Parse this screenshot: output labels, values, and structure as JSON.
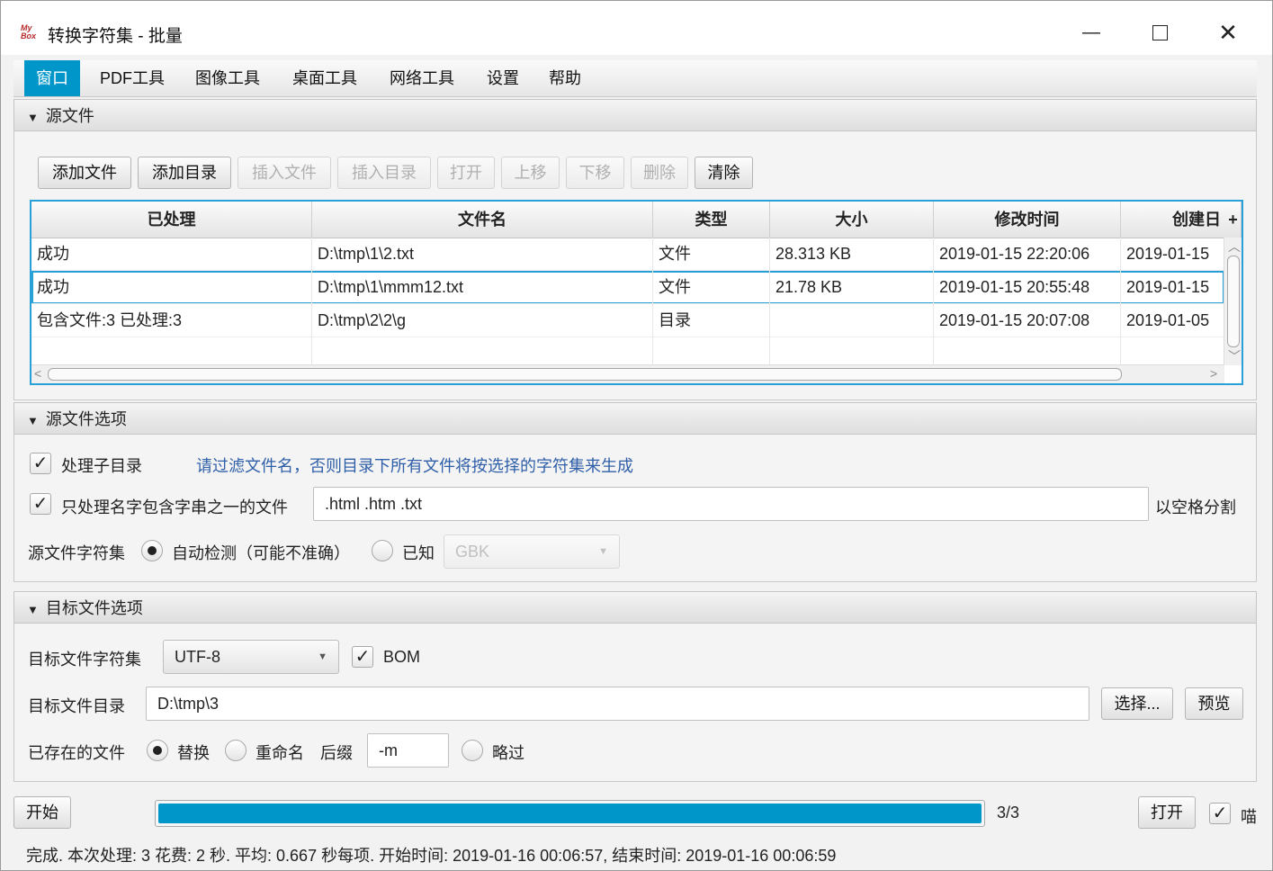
{
  "window": {
    "logo_text": "My Box",
    "title": "转换字符集 - 批量",
    "minimize_glyph": "—",
    "close_glyph": "✕"
  },
  "menu": [
    "窗口",
    "PDF工具",
    "图像工具",
    "桌面工具",
    "网络工具",
    "设置",
    "帮助"
  ],
  "source_files": {
    "header": "源文件",
    "toolbar": {
      "add_file": "添加文件",
      "add_dir": "添加目录",
      "insert_file": "插入文件",
      "insert_dir": "插入目录",
      "open": "打开",
      "move_up": "上移",
      "move_down": "下移",
      "delete": "删除",
      "clear": "清除"
    },
    "columns": [
      "已处理",
      "文件名",
      "类型",
      "大小",
      "修改时间",
      "创建日"
    ],
    "column_menu_glyph": "+",
    "rows": [
      [
        "成功",
        "D:\\tmp\\1\\2.txt",
        "文件",
        "28.313 KB",
        "2019-01-15 22:20:06",
        "2019-01-15"
      ],
      [
        "成功",
        "D:\\tmp\\1\\mmm12.txt",
        "文件",
        "21.78 KB",
        "2019-01-15 20:55:48",
        "2019-01-15"
      ],
      [
        "包含文件:3  已处理:3",
        "D:\\tmp\\2\\2\\g",
        "目录",
        "",
        "2019-01-15 20:07:08",
        "2019-01-05"
      ]
    ],
    "selected_row": 1
  },
  "source_options": {
    "header": "源文件选项",
    "subdir_label": "处理子目录",
    "subdir_checked": true,
    "subdir_hint": "请过滤文件名，否则目录下所有文件将按选择的字符集来生成",
    "filter_label": "只处理名字包含字串之一的文件",
    "filter_checked": true,
    "filter_value": ".html  .htm  .txt",
    "filter_note": "以空格分割",
    "charset_label": "源文件字符集",
    "auto_label": "自动检测（可能不准确）",
    "known_label": "已知",
    "known_value": "GBK",
    "auto_selected": true
  },
  "target_options": {
    "header": "目标文件选项",
    "charset_label": "目标文件字符集",
    "charset_value": "UTF-8",
    "bom_label": "BOM",
    "bom_checked": true,
    "dir_label": "目标文件目录",
    "dir_value": "D:\\tmp\\3",
    "choose_button": "选择...",
    "preview_button": "预览",
    "exists_label": "已存在的文件",
    "replace_label": "替换",
    "rename_label": "重命名",
    "suffix_label": "后缀",
    "suffix_value": "-m",
    "skip_label": "略过",
    "replace_selected": true
  },
  "bottom": {
    "start_button": "开始",
    "progress": 1.0,
    "progress_text": "3/3",
    "open_button": "打开",
    "meow_label": "喵",
    "meow_checked": true
  },
  "status_text": "完成. 本次处理: 3 花费: 2 秒. 平均: 0.667 秒每项. 开始时间: 2019-01-16 00:06:57, 结束时间: 2019-01-16 00:06:59",
  "colors": {
    "accent": "#0096c9",
    "selection_border": "#2aa0d8",
    "hint_text": "#2f5fa8"
  }
}
